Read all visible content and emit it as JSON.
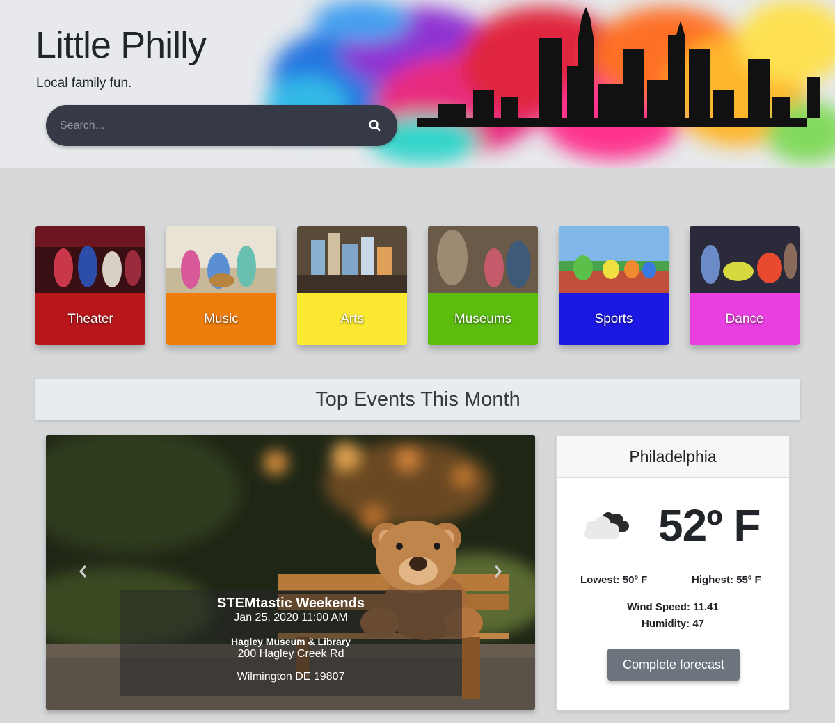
{
  "header": {
    "site_title": "Little Philly",
    "tagline": "Local family fun.",
    "search": {
      "placeholder": "Search..."
    }
  },
  "categories": [
    {
      "label": "Theater",
      "color": "#b7161b"
    },
    {
      "label": "Music",
      "color": "#ef7d0b"
    },
    {
      "label": "Arts",
      "color": "#fbe831"
    },
    {
      "label": "Museums",
      "color": "#5cbd0f"
    },
    {
      "label": "Sports",
      "color": "#1c18e3"
    },
    {
      "label": "Dance",
      "color": "#e83fe0"
    }
  ],
  "section": {
    "title": "Top Events This Month"
  },
  "carousel": {
    "event_title": "STEMtastic Weekends",
    "event_date": "Jan 25, 2020 11:00 AM",
    "venue": "Hagley Museum & Library",
    "street": "200 Hagley Creek Rd",
    "city": "Wilmington DE 19807"
  },
  "weather": {
    "city": "Philadelphia",
    "temperature": "52º F",
    "lowest": "Lowest: 50º F",
    "highest": "Highest: 55º F",
    "wind_speed": "Wind Speed: 11.41",
    "humidity": "Humidity: 47",
    "forecast_button": "Complete forecast",
    "icon": "cloudy-icon"
  }
}
